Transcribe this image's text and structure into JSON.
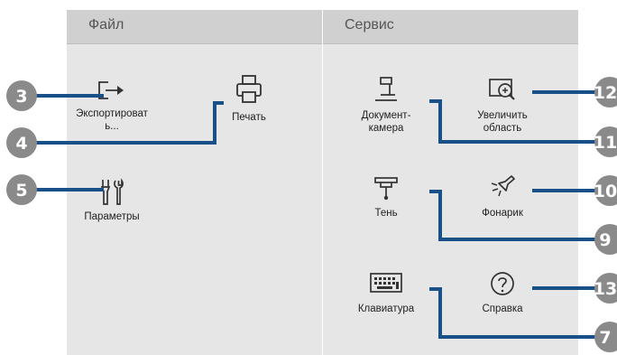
{
  "sections": {
    "file": {
      "title": "Файл"
    },
    "service": {
      "title": "Сервис"
    }
  },
  "tools": {
    "export": {
      "label": "Экспортироват\nь...",
      "icon": "export-icon"
    },
    "print": {
      "label": "Печать",
      "icon": "printer-icon"
    },
    "settings": {
      "label": "Параметры",
      "icon": "tools-icon"
    },
    "doc_camera": {
      "label": "Документ-\nкамера",
      "icon": "document-camera-icon"
    },
    "zoom": {
      "label": "Увеличить\nобласть",
      "icon": "zoom-in-icon"
    },
    "shade": {
      "label": "Тень",
      "icon": "shade-icon"
    },
    "flashlight": {
      "label": "Фонарик",
      "icon": "flashlight-icon"
    },
    "keyboard": {
      "label": "Клавиатура",
      "icon": "keyboard-icon"
    },
    "help": {
      "label": "Справка",
      "icon": "help-icon"
    }
  },
  "callouts": {
    "export": "3",
    "print": "4",
    "settings": "5",
    "zoom": "12",
    "doc_camera": "11",
    "flashlight": "10",
    "shade": "9",
    "help": "13",
    "keyboard": "7"
  },
  "colors": {
    "callout_line": "#1a5088",
    "callout_badge": "#8a8a8a",
    "panel_bg": "#e6e6e6",
    "header_bg": "#d0d0d0"
  }
}
